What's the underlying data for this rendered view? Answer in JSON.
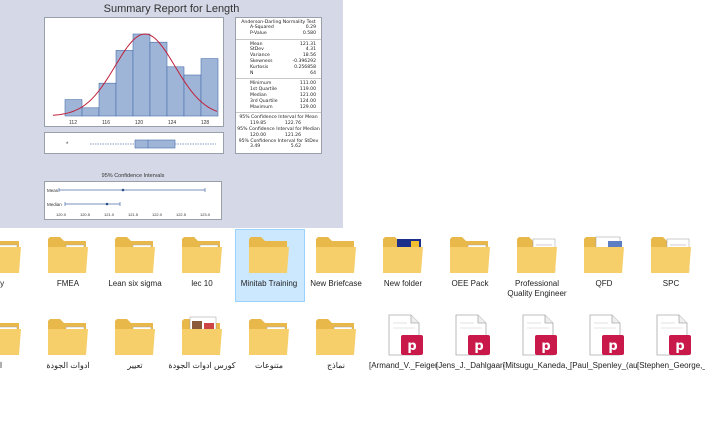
{
  "report": {
    "title": "Summary Report for Length",
    "histogram": {
      "x_ticks": [
        "112",
        "116",
        "120",
        "124",
        "128"
      ],
      "bar_heights": [
        2,
        1,
        4,
        8,
        10,
        9,
        6,
        5,
        7
      ]
    },
    "stats_header": "Anderson-Darling Normality Test",
    "normality": [
      [
        "A-Squared",
        "0.29"
      ],
      [
        "P-Value",
        "0.580"
      ]
    ],
    "descriptives": [
      [
        "Mean",
        "121.31"
      ],
      [
        "StDev",
        "4.31"
      ],
      [
        "Variance",
        "18.56"
      ],
      [
        "Skewness",
        "-0.396292"
      ],
      [
        "Kurtosis",
        "0.256858"
      ],
      [
        "N",
        "64"
      ]
    ],
    "quartiles": [
      [
        "Minimum",
        "111.00"
      ],
      [
        "1st Quartile",
        "119.00"
      ],
      [
        "Median",
        "121.00"
      ],
      [
        "3rd Quartile",
        "124.00"
      ],
      [
        "Maximum",
        "129.00"
      ]
    ],
    "ci_mean_label": "95% Confidence Interval for Mean",
    "ci_mean": [
      "119.85",
      "122.76"
    ],
    "ci_median_label": "95% Confidence Interval for Median",
    "ci_median": [
      "120.00",
      "121.26"
    ],
    "ci_stdev_label": "95% Confidence Interval for StDev",
    "ci_stdev": [
      "3.49",
      "5.62"
    ],
    "ci_chart_title": "95% Confidence Intervals",
    "ci_rows": [
      "Mean",
      "Median"
    ],
    "ci_ticks": [
      "120.0",
      "120.5",
      "121.0",
      "121.5",
      "122.0",
      "122.5",
      "123.0"
    ]
  },
  "row1": [
    {
      "label": "ty",
      "type": "folder-green"
    },
    {
      "label": "FMEA",
      "type": "folder-green"
    },
    {
      "label": "Lean six sigma",
      "type": "folder-pink"
    },
    {
      "label": "lec 10",
      "type": "folder-green"
    },
    {
      "label": "Minitab Training",
      "type": "folder-plain",
      "selected": true
    },
    {
      "label": "New Briefcase",
      "type": "folder-plain"
    },
    {
      "label": "New folder",
      "type": "folder-blue"
    },
    {
      "label": "OEE Pack",
      "type": "folder-pink"
    },
    {
      "label": "Professional Quality Engineer",
      "type": "folder-paper"
    },
    {
      "label": "QFD",
      "type": "folder-photo"
    },
    {
      "label": "SPC",
      "type": "folder-paper"
    }
  ],
  "row2": [
    {
      "label": "ا",
      "type": "folder-red"
    },
    {
      "label": "ادوات الجودة",
      "type": "folder-pink"
    },
    {
      "label": "تعيير",
      "type": "folder-pink"
    },
    {
      "label": "كورس ادوات الجودة",
      "type": "folder-docs"
    },
    {
      "label": "متنوعات",
      "type": "folder-green"
    },
    {
      "label": "نماذج",
      "type": "folder-green"
    },
    {
      "label": "[Armand_V._Feigenbaum]_Total_Q",
      "type": "pdf"
    },
    {
      "label": "[Jens_J._Dahlgaard,_Kai_Kristensen",
      "type": "pdf"
    },
    {
      "label": "[Mitsugu_Kaneda,_Yoshifumi_Kim",
      "type": "pdf"
    },
    {
      "label": "[Paul_Spenley_(auth.)]_World_Cla",
      "type": "pdf"
    },
    {
      "label": "[Stephen_George,_Arnold_Weime",
      "type": "pdf"
    }
  ]
}
